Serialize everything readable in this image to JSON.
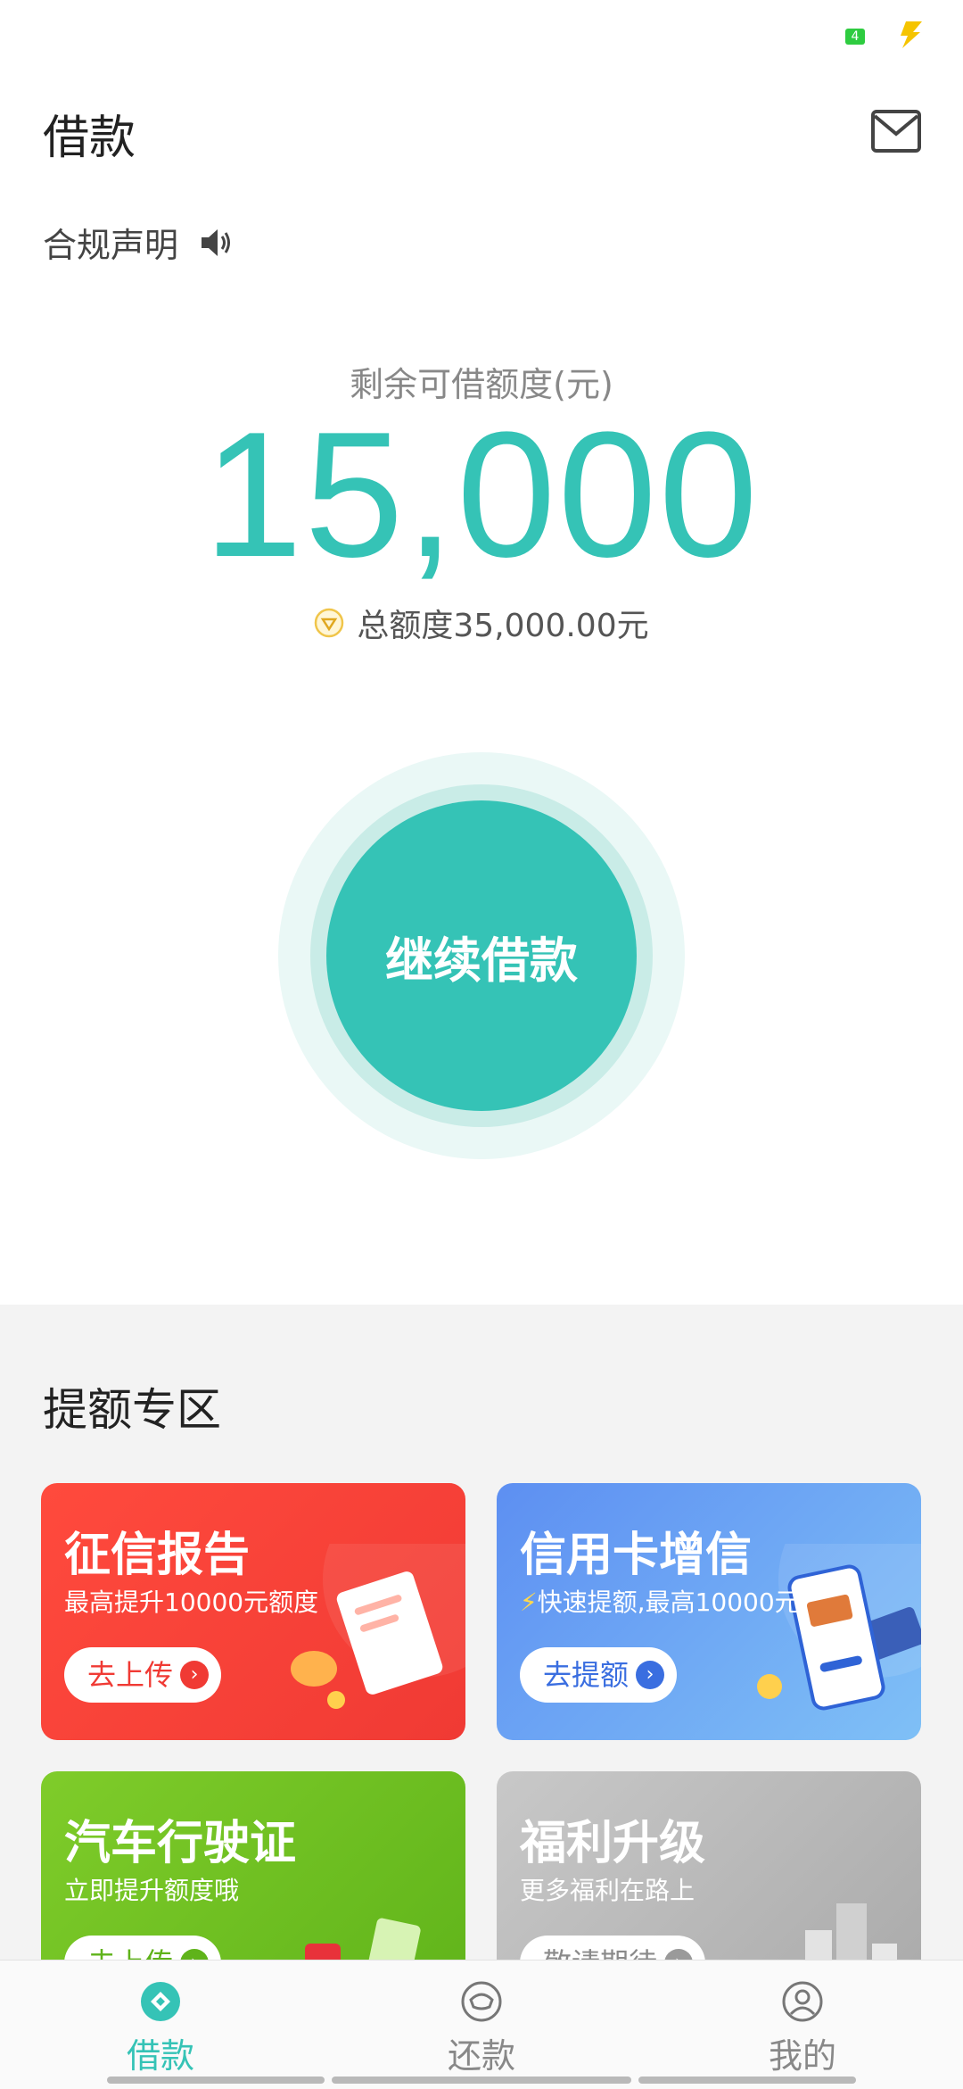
{
  "status_bar": {
    "battery_level": "4"
  },
  "header": {
    "title": "借款"
  },
  "notice": {
    "label": "合规声明"
  },
  "quota": {
    "label": "剩余可借额度(元)",
    "amount": "15,000",
    "total": "总额度35,000.00元"
  },
  "main_button": {
    "label": "继续借款"
  },
  "boost_zone": {
    "title": "提额专区",
    "cards": [
      {
        "title": "征信报告",
        "subtitle": "最高提升10000元额度",
        "button": "去上传",
        "color": "#f03a34"
      },
      {
        "title": "信用卡增信",
        "subtitle": "快速提额,最高10000元",
        "button": "去提额",
        "color": "#5d8ff2"
      },
      {
        "title": "汽车行驶证",
        "subtitle": "立即提升额度哦",
        "button": "去上传",
        "color": "#6fc021"
      },
      {
        "title": "福利升级",
        "subtitle": "更多福利在路上",
        "button": "敬请期待",
        "color": "#b5b5b5"
      }
    ]
  },
  "tabbar": {
    "items": [
      {
        "label": "借款",
        "icon": "borrow-icon",
        "active": true
      },
      {
        "label": "还款",
        "icon": "repay-icon",
        "active": false
      },
      {
        "label": "我的",
        "icon": "profile-icon",
        "active": false
      }
    ]
  },
  "colors": {
    "accent": "#35c3b6",
    "red": "#f03a34",
    "blue": "#5d8ff2",
    "green": "#6fc021",
    "gray": "#b5b5b5"
  }
}
